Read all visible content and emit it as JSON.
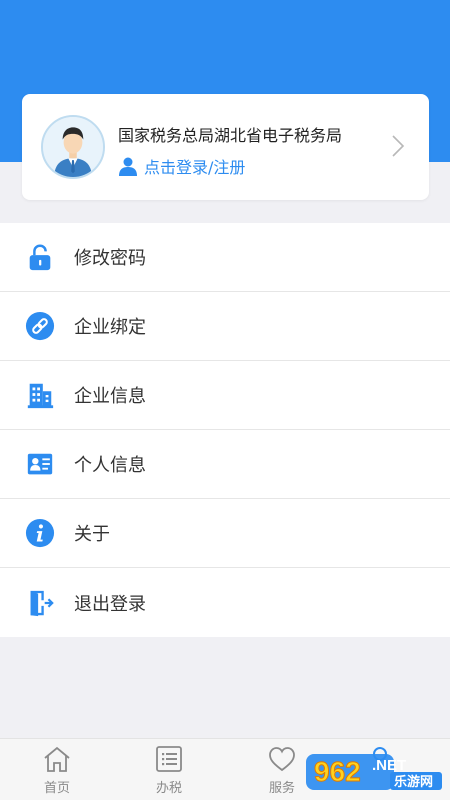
{
  "header": {
    "org_name": "国家税务总局湖北省电子税务局",
    "login_text": "点击登录/注册"
  },
  "menu": [
    {
      "label": "修改密码",
      "icon": "lock-icon"
    },
    {
      "label": "企业绑定",
      "icon": "link-icon"
    },
    {
      "label": "企业信息",
      "icon": "building-icon"
    },
    {
      "label": "个人信息",
      "icon": "id-card-icon"
    },
    {
      "label": "关于",
      "icon": "info-icon"
    },
    {
      "label": "退出登录",
      "icon": "logout-icon"
    }
  ],
  "tabbar": [
    {
      "label": "首页",
      "icon": "home-icon"
    },
    {
      "label": "办税",
      "icon": "list-icon"
    },
    {
      "label": "服务",
      "icon": "heart-icon"
    }
  ],
  "watermark": {
    "number": "962",
    "net": ".NET",
    "text": "乐游网"
  },
  "colors": {
    "accent": "#2d8cf0",
    "background": "#f0f0f4"
  }
}
